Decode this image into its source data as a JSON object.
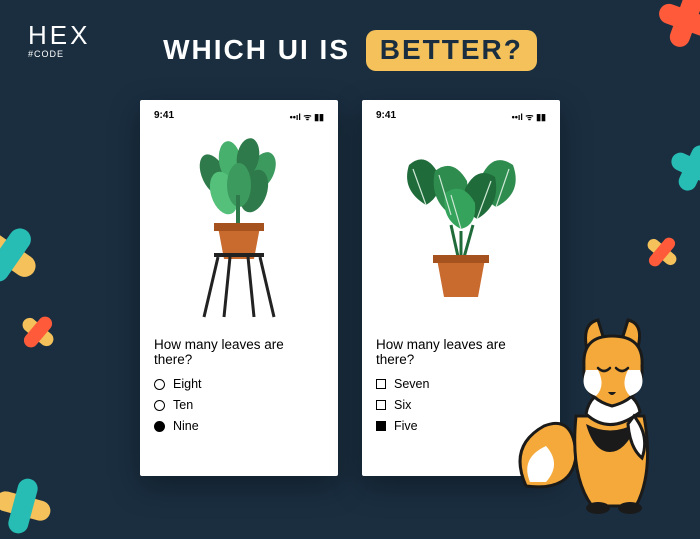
{
  "logo": {
    "main": "HEX",
    "sub": "#CODE"
  },
  "title": {
    "lead": "WHICH UI IS ",
    "badge": "BETTER?"
  },
  "phoneA": {
    "time": "9:41",
    "signal": "••ıl ᯤ ▮▮",
    "question": "How many leaves are there?",
    "opts": [
      {
        "label": "Eight",
        "selected": false
      },
      {
        "label": "Ten",
        "selected": false
      },
      {
        "label": "Nine",
        "selected": true
      }
    ]
  },
  "phoneB": {
    "time": "9:41",
    "signal": "••ıl ᯤ ▮▮",
    "question": "How many leaves are there?",
    "opts": [
      {
        "label": "Seven",
        "selected": false
      },
      {
        "label": "Six",
        "selected": false
      },
      {
        "label": "Five",
        "selected": true
      }
    ]
  }
}
